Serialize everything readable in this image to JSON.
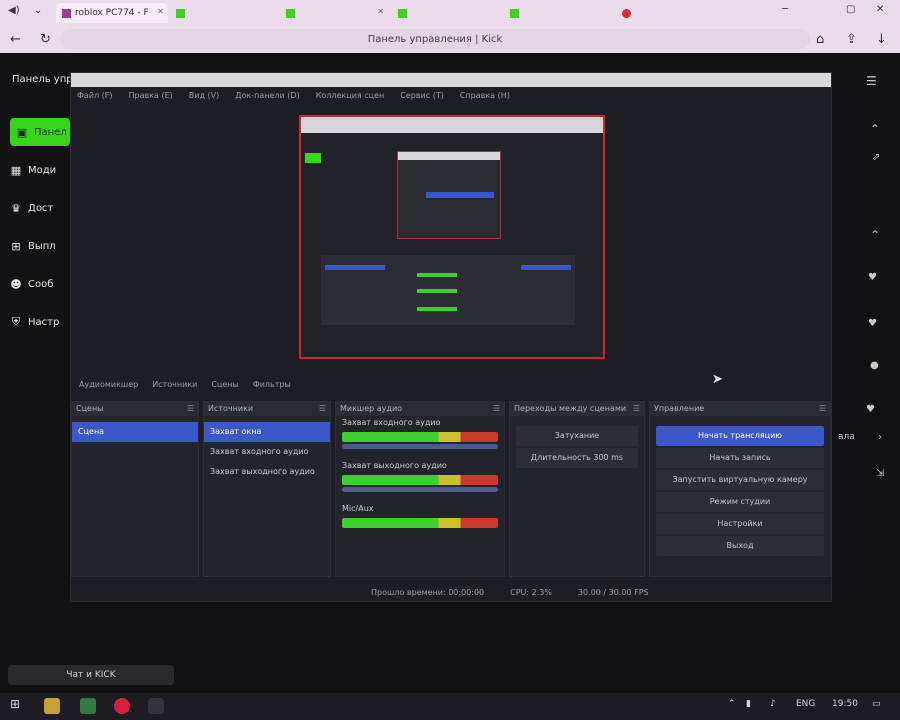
{
  "browser": {
    "tabs": [
      {
        "label": "roblox PC774 - F",
        "color": "#a23a8f"
      },
      {
        "label": "",
        "color": "#3fcf1f"
      },
      {
        "label": "",
        "color": "#3fcf1f"
      },
      {
        "label": "",
        "color": "#3fcf1f"
      },
      {
        "label": "",
        "color": "#3fcf1f"
      },
      {
        "label": "",
        "color": "#e0283a"
      }
    ],
    "address": "Панель управления | Kick"
  },
  "sidebar": {
    "header": "Панель упр",
    "items": [
      {
        "label": "Панел",
        "icon": "dashboard-icon"
      },
      {
        "label": "Моди",
        "icon": "moderation-icon"
      },
      {
        "label": "Дост",
        "icon": "trophy-icon"
      },
      {
        "label": "Выпл",
        "icon": "payout-icon"
      },
      {
        "label": "Сооб",
        "icon": "community-icon"
      },
      {
        "label": "Настр",
        "icon": "settings-shield-icon"
      }
    ]
  },
  "right_panel": {
    "label": "ала"
  },
  "obs": {
    "menu": [
      "Файл (F)",
      "Правка (E)",
      "Вид (V)",
      "Док-панели (D)",
      "Коллекция сцен",
      "Сервис (T)",
      "Справка (H)"
    ],
    "scene_bar": [
      "Аудиомикшер",
      "Источники",
      "Сцены",
      "Фильтры"
    ],
    "docks": {
      "scenes": {
        "title": "Сцены",
        "items": [
          "Сцена"
        ]
      },
      "sources": {
        "title": "Источники",
        "items": [
          "Захват окна",
          "Захват входного аудио",
          "Захват выходного аудио"
        ]
      },
      "mixer": {
        "title": "Микшер аудио",
        "channels": [
          "Захват входного аудио",
          "Захват выходного аудио",
          "Mic/Aux"
        ]
      },
      "transitions": {
        "title": "Переходы между сценами",
        "items": [
          "Затухание",
          "Длительность 300 ms"
        ]
      },
      "controls": {
        "title": "Управление",
        "buttons": [
          "Начать трансляцию",
          "Начать запись",
          "Запустить виртуальную камеру",
          "Режим студии",
          "Настройки",
          "Выход"
        ]
      }
    },
    "status": [
      "Прошло времени: 00:00:00",
      "CPU: 2.3%",
      "30.00 / 30.00 FPS"
    ]
  },
  "notification": "Чат и KICK",
  "taskbar": {
    "clock": "19:50",
    "lang": "ENG"
  },
  "colors": {
    "accent": "#39d41c",
    "obs_select": "#3b58c9",
    "record_red": "#d0243a"
  }
}
